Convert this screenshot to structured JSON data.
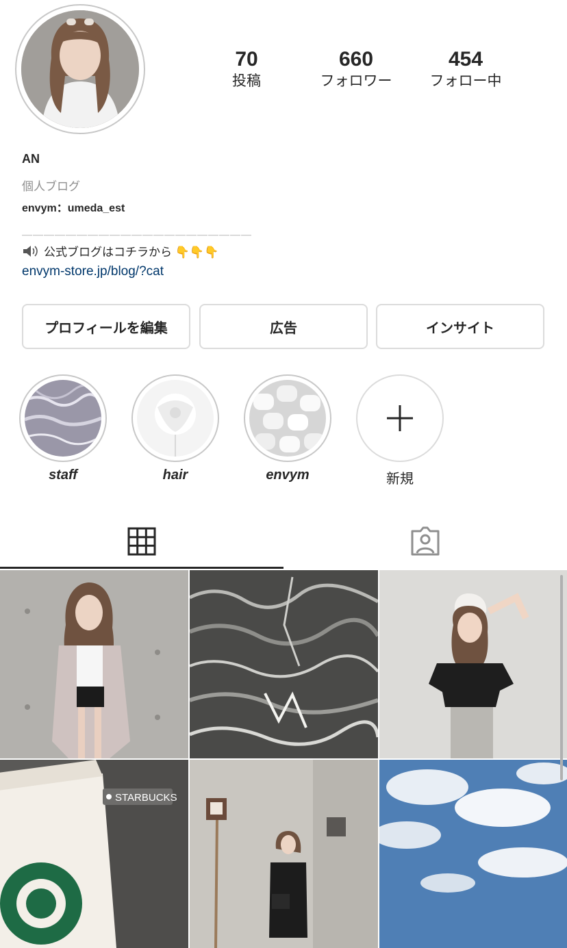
{
  "profile": {
    "name": "AN",
    "category": "個人ブログ",
    "bio_line1": "envym：umeda_est",
    "bio_divider": "＿＿＿＿＿＿＿＿＿＿＿＿＿＿＿＿＿＿＿＿＿",
    "bio_line2": "公式ブログはコチラから 👇👇👇",
    "link": "envym-store.jp/blog/?cat"
  },
  "stats": [
    {
      "value": "70",
      "label": "投稿"
    },
    {
      "value": "660",
      "label": "フォロワー"
    },
    {
      "value": "454",
      "label": "フォロー中"
    }
  ],
  "buttons": {
    "edit_profile": "プロフィールを編集",
    "ads": "広告",
    "insights": "インサイト"
  },
  "highlights": [
    {
      "label": "staff"
    },
    {
      "label": "hair"
    },
    {
      "label": "envym"
    },
    {
      "label": "新規"
    }
  ],
  "tabs": [
    {
      "icon": "grid-icon",
      "active": true
    },
    {
      "icon": "tagged-person-icon",
      "active": false
    }
  ],
  "posts": [
    {
      "overlay": ""
    },
    {
      "overlay": ""
    },
    {
      "overlay": ""
    },
    {
      "overlay": "STARBUCKS"
    },
    {
      "overlay": ""
    },
    {
      "overlay": ""
    }
  ],
  "colors": {
    "text": "#262626",
    "secondary": "#8e8e8e",
    "link": "#00376b",
    "border": "#dbdbdb"
  }
}
